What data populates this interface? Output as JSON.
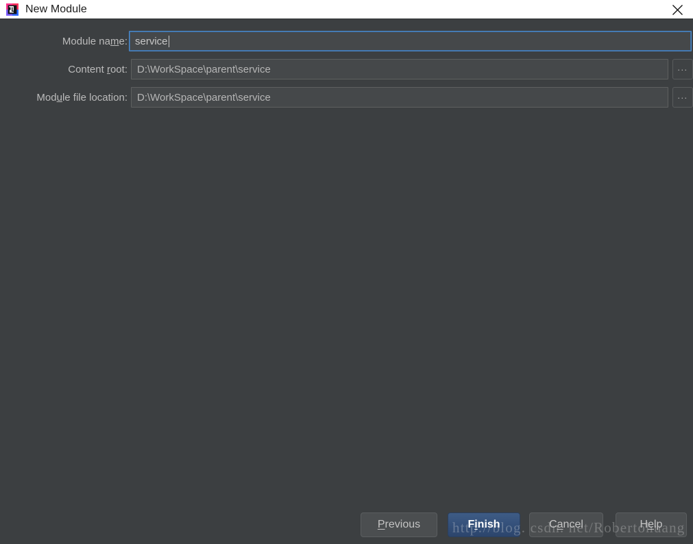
{
  "window": {
    "title": "New Module",
    "app_icon": "intellij-idea-icon",
    "close_icon": "close-icon",
    "titlebar_background": "#ffffff",
    "body_background": "#3c3f41"
  },
  "form": {
    "fields": [
      {
        "label_before": "Module na",
        "label_mnemonic": "m",
        "label_after": "e:",
        "value": "service",
        "focused": true,
        "has_browse": false,
        "browse_label": "..."
      },
      {
        "label_before": "Content ",
        "label_mnemonic": "r",
        "label_after": "oot:",
        "value": "D:\\WorkSpace\\parent\\service",
        "focused": false,
        "has_browse": true,
        "browse_label": "..."
      },
      {
        "label_before": "Mod",
        "label_mnemonic": "u",
        "label_after": "le file location:",
        "value": "D:\\WorkSpace\\parent\\service",
        "focused": false,
        "has_browse": true,
        "browse_label": "..."
      }
    ]
  },
  "buttons": {
    "previous": {
      "before": "",
      "mnemonic": "P",
      "after": "revious"
    },
    "finish": {
      "before": "F",
      "mnemonic": "i",
      "after": "nish"
    },
    "cancel": {
      "before": "C",
      "mnemonic": "a",
      "after": "ncel"
    },
    "help": {
      "before": "H",
      "mnemonic": "e",
      "after": "lp"
    }
  },
  "watermark": {
    "text": "http://blog. csdn. net/Robertohuang"
  },
  "colors": {
    "accent_focus_border": "#4b88c9",
    "default_button_blue": "#34507a",
    "text_primary": "#bbbbbb",
    "title_text": "#1b1b1b"
  }
}
